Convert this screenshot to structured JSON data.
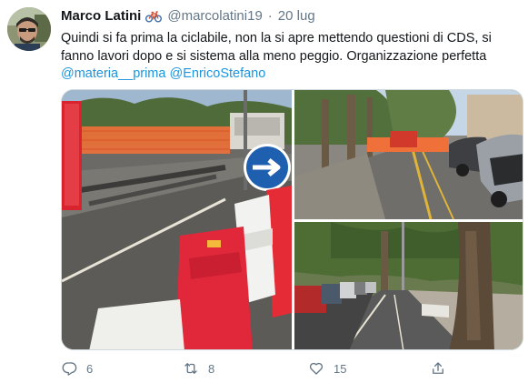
{
  "tweet": {
    "author_name": "Marco Latini",
    "author_emoji_icon": "bicycle-icon",
    "handle": "@marcolatini19",
    "separator": "·",
    "date": "20 lug",
    "text_line": "Quindi si fa prima la ciclabile, non la si apre mettendo questioni di CDS, si fanno lavori dopo e si sistema alla meno peggio. Organizzazione perfetta",
    "mentions": [
      "@materia__prima",
      "@EnricoStefano"
    ]
  },
  "actions": {
    "reply": {
      "icon": "reply-icon",
      "count": "6"
    },
    "retweet": {
      "icon": "retweet-icon",
      "count": "8"
    },
    "like": {
      "icon": "heart-icon",
      "count": "15"
    },
    "share": {
      "icon": "share-icon"
    }
  },
  "colors": {
    "text": "#14171a",
    "muted": "#657786",
    "link": "#1b95e0",
    "barrier_red": "#e0283a",
    "fence_orange": "#f2652b"
  }
}
